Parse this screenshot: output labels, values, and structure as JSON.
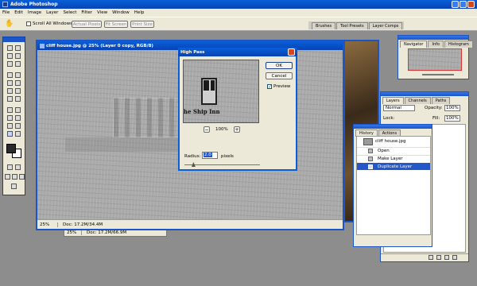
{
  "app": {
    "title": "Adobe Photoshop"
  },
  "menu": [
    "File",
    "Edit",
    "Image",
    "Layer",
    "Select",
    "Filter",
    "View",
    "Window",
    "Help"
  ],
  "options": {
    "scroll_all": "Scroll All Windows",
    "buttons": [
      "Actual Pixels",
      "Fit Screen",
      "Print Size"
    ]
  },
  "palette_well": [
    "Brushes",
    "Tool Presets",
    "Layer Comps"
  ],
  "doc": {
    "title": "cliff house.jpg @ 25% (Layer 0 copy, RGB/8)",
    "zoom": "25%",
    "docsize": "Doc: 17.2M/34.4M"
  },
  "doc2": {
    "zoom": "25%",
    "docsize": "Doc: 17.2M/66.9M"
  },
  "dialog": {
    "title": "High Pass",
    "ok": "OK",
    "cancel": "Cancel",
    "preview": "Preview",
    "preview_zoom": "100%",
    "radius_label": "Radius:",
    "radius_value": "2.0",
    "radius_unit": "pixels",
    "radius_slider": 0.12,
    "sign_text": "he Ship Inn"
  },
  "navigator": {
    "tabs": [
      "Navigator",
      "Info",
      "Histogram"
    ]
  },
  "layers": {
    "tabs": [
      "Layers",
      "Channels",
      "Paths"
    ],
    "blend": "Normal",
    "opacity_label": "Opacity:",
    "opacity": "100%",
    "lock_label": "Lock:",
    "fill_label": "Fill:",
    "fill": "100%"
  },
  "history": {
    "tabs": [
      "History",
      "Actions"
    ],
    "snapshot": "cliff house.jpg",
    "items": [
      "Open",
      "Make Layer",
      "Duplicate Layer"
    ]
  },
  "colors": {
    "accent": "#0a5fd8",
    "selection": "#2457c8"
  }
}
